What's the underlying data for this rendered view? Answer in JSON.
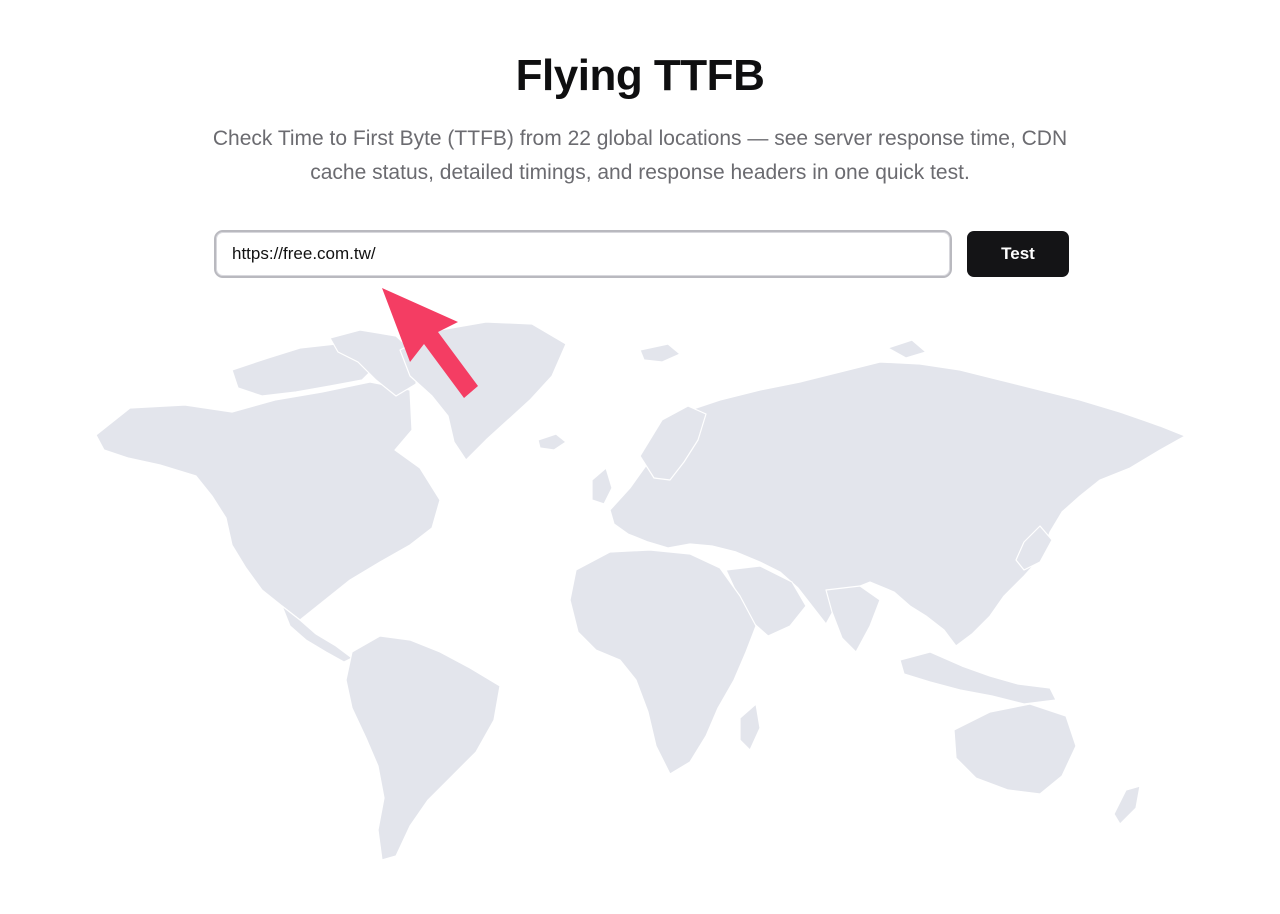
{
  "header": {
    "title": "Flying TTFB",
    "subtitle": "Check Time to First Byte (TTFB) from 22 global locations — see server response time, CDN cache status, detailed timings, and response headers in one quick test."
  },
  "form": {
    "url_value": "https://free.com.tw/",
    "test_label": "Test"
  },
  "icons": {
    "map": "world-map-icon",
    "annotation": "pointer-arrow-icon"
  },
  "colors": {
    "map_fill": "#e3e5ec",
    "arrow": "#f43d63",
    "button_bg": "#141416",
    "subtitle": "#6b6b70"
  }
}
